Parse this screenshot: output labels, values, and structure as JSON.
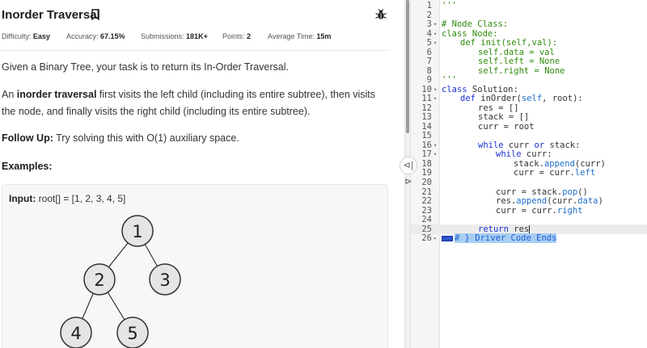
{
  "problem": {
    "title": "Inorder Traversal",
    "difficulty_label": "Difficulty:",
    "difficulty": "Easy",
    "accuracy_label": "Accuracy:",
    "accuracy": "67.15%",
    "submissions_label": "Submissions:",
    "submissions": "181K+",
    "points_label": "Points:",
    "points": "2",
    "avg_time_label": "Average Time:",
    "avg_time": "15m",
    "intro": "Given a Binary Tree, your task is to return its In-Order Traversal.",
    "def_prefix": "An ",
    "def_bold": "inorder traversal",
    "def_rest_1": " first visits the left child (including its entire subtree), then visits",
    "def_rest_2": "the node, and finally visits the right child (including its entire subtree).",
    "followup_label": "Follow Up:",
    "followup_text": " Try solving this with O(1) auxiliary space.",
    "examples_heading": "Examples:",
    "input_label": "Input:",
    "input_value": " root[] = [1, 2, 3, 4, 5]",
    "tree_nodes": [
      "1",
      "2",
      "3",
      "4",
      "5"
    ]
  },
  "icons": {
    "bookmark": "bookmark-icon",
    "bug": "bug-icon",
    "splitter": "⊲|⊳"
  },
  "editor": {
    "lines": [
      {
        "n": "1",
        "fold": ""
      },
      {
        "n": "2",
        "fold": ""
      },
      {
        "n": "3",
        "fold": "▾"
      },
      {
        "n": "4",
        "fold": "▾"
      },
      {
        "n": "5",
        "fold": "▾"
      },
      {
        "n": "6",
        "fold": ""
      },
      {
        "n": "7",
        "fold": ""
      },
      {
        "n": "8",
        "fold": ""
      },
      {
        "n": "9",
        "fold": ""
      },
      {
        "n": "10",
        "fold": "▾"
      },
      {
        "n": "11",
        "fold": "▾"
      },
      {
        "n": "12",
        "fold": ""
      },
      {
        "n": "13",
        "fold": ""
      },
      {
        "n": "14",
        "fold": ""
      },
      {
        "n": "15",
        "fold": ""
      },
      {
        "n": "16",
        "fold": "▾"
      },
      {
        "n": "17",
        "fold": "▾"
      },
      {
        "n": "18",
        "fold": ""
      },
      {
        "n": "19",
        "fold": ""
      },
      {
        "n": "20",
        "fold": ""
      },
      {
        "n": "21",
        "fold": ""
      },
      {
        "n": "22",
        "fold": ""
      },
      {
        "n": "23",
        "fold": ""
      },
      {
        "n": "24",
        "fold": ""
      },
      {
        "n": "25",
        "fold": ""
      },
      {
        "n": "26",
        "fold": "▸"
      }
    ],
    "code": {
      "l1": "'''",
      "l3": "# Node Class:",
      "l4_kw": "class",
      "l4": " Node:",
      "l5_kw": "def",
      "l5": " init(self,val):",
      "l6": "self.data = val",
      "l7_a": "self.left = ",
      "l7_b": "None",
      "l8_a": "self.right = ",
      "l8_b": "None",
      "l9": "'''",
      "l10_kw": "class",
      "l10": " Solution:",
      "l11_kw": "def",
      "l11_a": " inOrder(",
      "l11_self": "self",
      "l11_b": ", root):",
      "l12": "res = []",
      "l13": "stack = []",
      "l14": "curr = root",
      "l16_kw": "while",
      "l16_a": " curr ",
      "l16_or": "or",
      "l16_b": " stack:",
      "l17_kw": "while",
      "l17": " curr:",
      "l18_a": "stack.",
      "l18_fn": "append",
      "l18_b": "(curr)",
      "l19_a": "curr = curr.",
      "l19_b": "left",
      "l21_a": "curr = stack.",
      "l21_fn": "pop",
      "l21_b": "()",
      "l22_a": "res.",
      "l22_fn": "append",
      "l22_b": "(curr.",
      "l22_c": "data",
      "l22_d": ")",
      "l23_a": "curr = curr.",
      "l23_b": "right",
      "l25_kw": "return",
      "l25": " res",
      "l26": "# } Driver Code Ends"
    }
  },
  "colors": {
    "keyword": "#1a32d6",
    "string": "#2e8b0c",
    "selection": "#a8cef2",
    "node_fill": "#e5e5e5",
    "node_stroke": "#333333"
  }
}
